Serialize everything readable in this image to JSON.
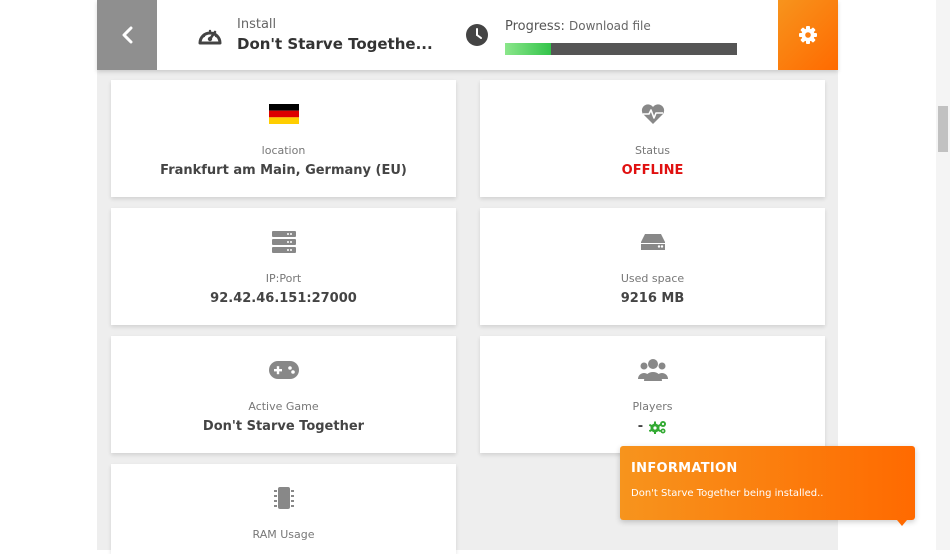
{
  "header": {
    "install_label": "Install",
    "install_title": "Don't Starve Togethe...",
    "progress_label": "Progress:",
    "progress_step": "Download file",
    "progress_fraction": 0.2
  },
  "cards": {
    "location": {
      "label": "location",
      "value": "Frankfurt am Main, Germany (EU)"
    },
    "status": {
      "label": "Status",
      "value": "OFFLINE"
    },
    "ipport": {
      "label": "IP:Port",
      "value": "92.42.46.151:27000"
    },
    "used_space": {
      "label": "Used space",
      "value": "9216 MB"
    },
    "active_game": {
      "label": "Active Game",
      "value": "Don't Starve Together"
    },
    "players": {
      "label": "Players",
      "value": "-"
    },
    "ram": {
      "label": "RAM Usage"
    }
  },
  "notification": {
    "title": "INFORMATION",
    "message": "Don't Starve Together being installed.."
  },
  "colors": {
    "accent": "#ff6a00",
    "offline": "#e01010",
    "progress": "#33c44a"
  }
}
